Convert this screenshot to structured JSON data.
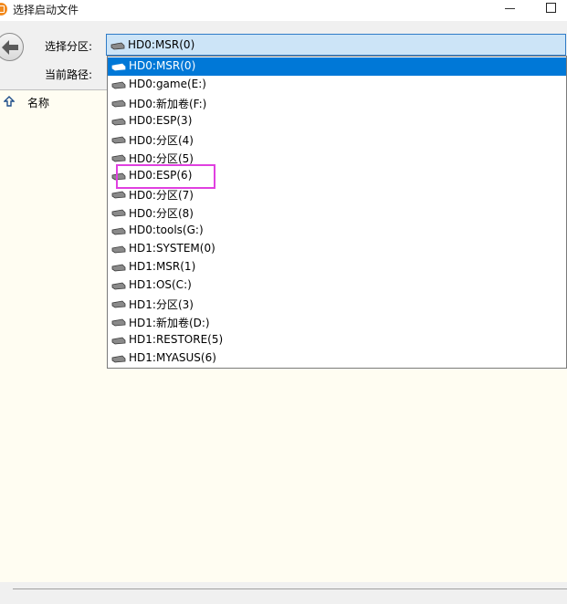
{
  "window": {
    "title": "选择启动文件",
    "accent_color": "#0078d7",
    "highlight_color": "#e040e0"
  },
  "toolbar": {
    "partition_label": "选择分区:",
    "path_label": "当前路径:",
    "selected_partition": "HD0:MSR(0)"
  },
  "file_list": {
    "name_column": "名称"
  },
  "dropdown": {
    "items": [
      {
        "label": "HD0:MSR(0)"
      },
      {
        "label": "HD0:game(E:)"
      },
      {
        "label": "HD0:新加卷(F:)"
      },
      {
        "label": "HD0:ESP(3)"
      },
      {
        "label": "HD0:分区(4)"
      },
      {
        "label": "HD0:分区(5)"
      },
      {
        "label": "HD0:ESP(6)"
      },
      {
        "label": "HD0:分区(7)"
      },
      {
        "label": "HD0:分区(8)"
      },
      {
        "label": "HD0:tools(G:)"
      },
      {
        "label": "HD1:SYSTEM(0)"
      },
      {
        "label": "HD1:MSR(1)"
      },
      {
        "label": "HD1:OS(C:)"
      },
      {
        "label": "HD1:分区(3)"
      },
      {
        "label": "HD1:新加卷(D:)"
      },
      {
        "label": "HD1:RESTORE(5)"
      },
      {
        "label": "HD1:MYASUS(6)"
      }
    ]
  },
  "icons": {
    "drive": "drive-icon",
    "back": "back-arrow-icon",
    "up": "up-arrow-icon",
    "app": "app-icon"
  }
}
